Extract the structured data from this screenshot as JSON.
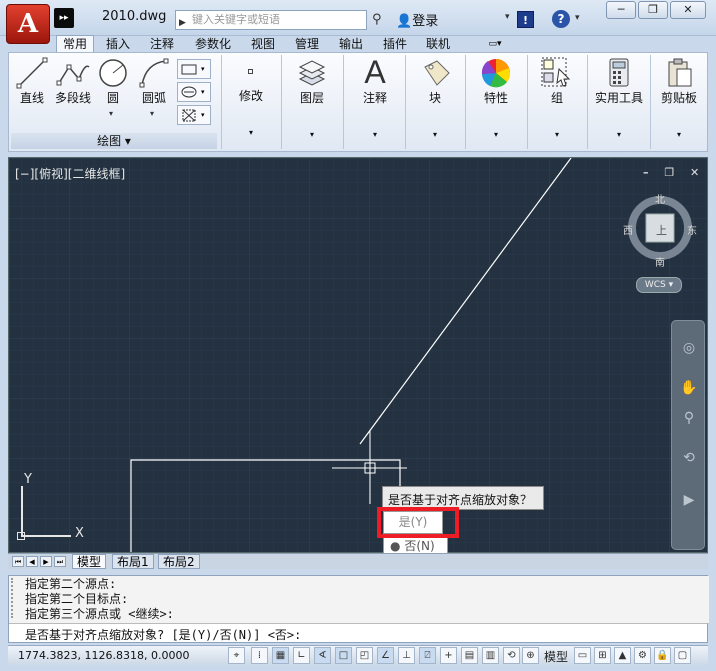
{
  "title_bar": {
    "app_button_glyph": "A",
    "quick_access_glyph": "▸▸",
    "document_title": "2010.dwg",
    "search_placeholder": "键入关键字或短语",
    "login_label": "登录",
    "help_glyph": "?",
    "exchange_glyph": "!",
    "minimize_glyph": "─",
    "restore_glyph": "❐",
    "close_glyph": "✕"
  },
  "ribbon_tabs": [
    "常用",
    "插入",
    "注释",
    "参数化",
    "视图",
    "管理",
    "输出",
    "插件",
    "联机"
  ],
  "ribbon_tab_extra": "▭▾",
  "draw_panel": {
    "tools": [
      "直线",
      "多段线",
      "圆",
      "圆弧"
    ],
    "footer_label": "绘图 ▾"
  },
  "ribbon_panels": [
    {
      "label": "修改"
    },
    {
      "label": "图层"
    },
    {
      "label": "注释"
    },
    {
      "label": "块"
    },
    {
      "label": "特性"
    },
    {
      "label": "组"
    },
    {
      "label": "实用工具"
    },
    {
      "label": "剪贴板"
    }
  ],
  "viewport": {
    "label": "[−][俯视][二维线框]",
    "controls": "– ❐ ✕",
    "compass": {
      "north": "北",
      "south": "南",
      "east": "东",
      "west": "西",
      "top": "上"
    },
    "wcs_label": "WCS ▾",
    "ucs_x": "X",
    "ucs_y": "Y"
  },
  "prompt": {
    "question": "是否基于对齐点缩放对象？",
    "yes_option": "是(Y)",
    "no_option": "否(N)"
  },
  "layout_tabs": [
    "模型",
    "布局1",
    "布局2"
  ],
  "command_history": [
    "指定第二个源点:",
    "指定第二个目标点:",
    "指定第三个源点或 <继续>:"
  ],
  "command_current": "是否基于对齐点缩放对象? [是(Y)/否(N)] <否>:",
  "status": {
    "coordinates": "1774.3823,  1126.8318,  0.0000",
    "model_label": "模型"
  },
  "colors": {
    "viewport_bg": "#233140",
    "grid_line": "#2e3e4f",
    "highlight_red": "#ee1c25",
    "app_red": "#c8291b"
  }
}
